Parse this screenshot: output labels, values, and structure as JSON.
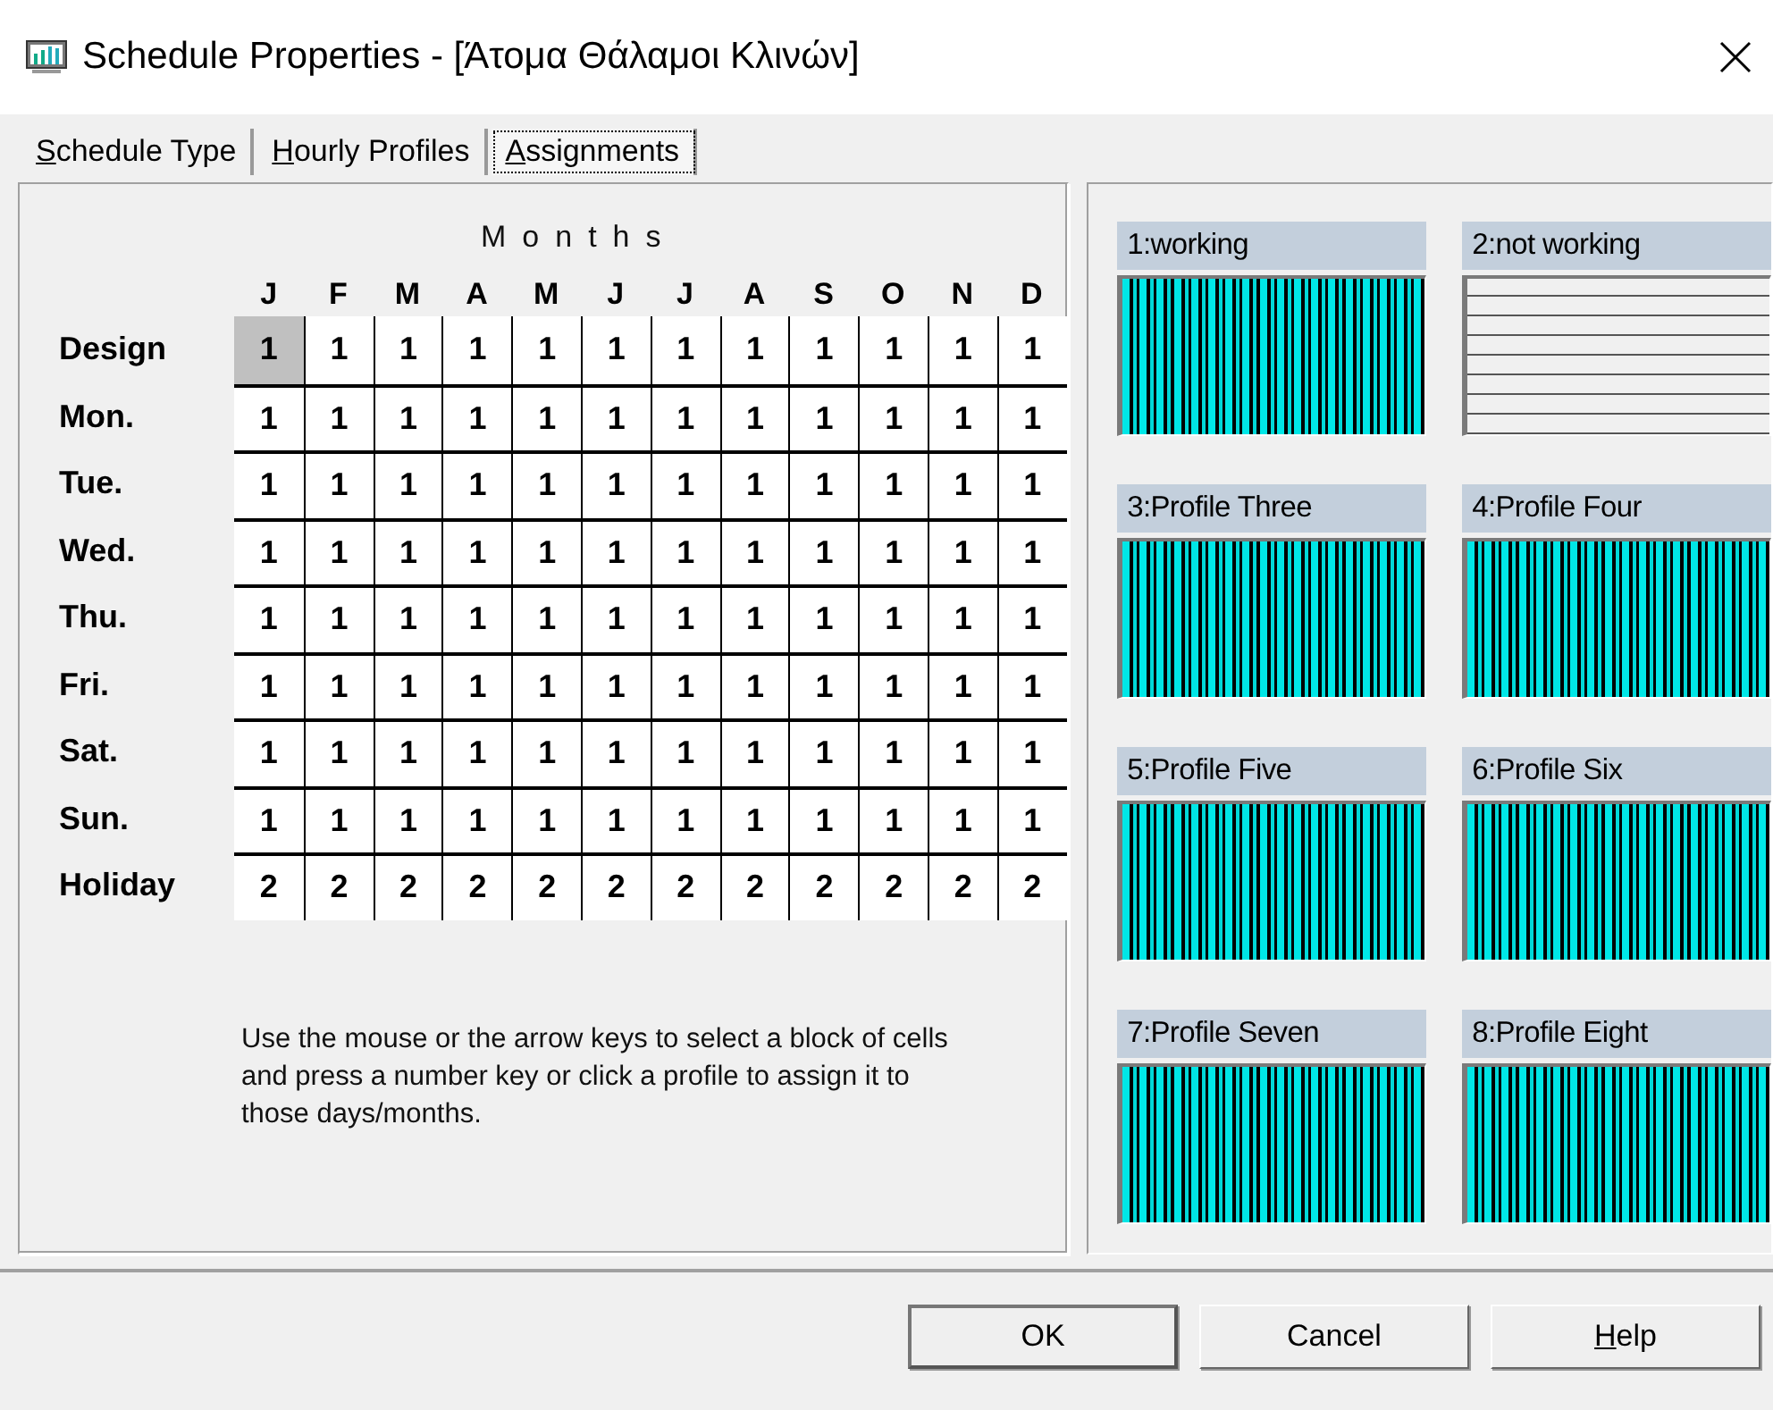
{
  "window": {
    "title": "Schedule Properties - [Άτομα Θάλαμοι Κλινών]"
  },
  "tabs": [
    {
      "label": "Schedule Type",
      "mnemonic": true,
      "selected": false
    },
    {
      "label": "Hourly Profiles",
      "mnemonic": true,
      "selected": false
    },
    {
      "label": "Assignments",
      "mnemonic": true,
      "selected": true
    }
  ],
  "grid": {
    "title": "Months",
    "columns": [
      "J",
      "F",
      "M",
      "A",
      "M",
      "J",
      "J",
      "A",
      "S",
      "O",
      "N",
      "D"
    ],
    "rows": [
      {
        "label": "Design",
        "cells": [
          {
            "value": "1",
            "selected": true
          },
          {
            "value": "1",
            "selected": false
          },
          {
            "value": "1",
            "selected": false
          },
          {
            "value": "1",
            "selected": false
          },
          {
            "value": "1",
            "selected": false
          },
          {
            "value": "1",
            "selected": false
          },
          {
            "value": "1",
            "selected": false
          },
          {
            "value": "1",
            "selected": false
          },
          {
            "value": "1",
            "selected": false
          },
          {
            "value": "1",
            "selected": false
          },
          {
            "value": "1",
            "selected": false
          },
          {
            "value": "1",
            "selected": false
          }
        ]
      },
      {
        "label": "Mon.",
        "cells": [
          {
            "value": "1",
            "selected": false
          },
          {
            "value": "1",
            "selected": false
          },
          {
            "value": "1",
            "selected": false
          },
          {
            "value": "1",
            "selected": false
          },
          {
            "value": "1",
            "selected": false
          },
          {
            "value": "1",
            "selected": false
          },
          {
            "value": "1",
            "selected": false
          },
          {
            "value": "1",
            "selected": false
          },
          {
            "value": "1",
            "selected": false
          },
          {
            "value": "1",
            "selected": false
          },
          {
            "value": "1",
            "selected": false
          },
          {
            "value": "1",
            "selected": false
          }
        ]
      },
      {
        "label": "Tue.",
        "cells": [
          {
            "value": "1",
            "selected": false
          },
          {
            "value": "1",
            "selected": false
          },
          {
            "value": "1",
            "selected": false
          },
          {
            "value": "1",
            "selected": false
          },
          {
            "value": "1",
            "selected": false
          },
          {
            "value": "1",
            "selected": false
          },
          {
            "value": "1",
            "selected": false
          },
          {
            "value": "1",
            "selected": false
          },
          {
            "value": "1",
            "selected": false
          },
          {
            "value": "1",
            "selected": false
          },
          {
            "value": "1",
            "selected": false
          },
          {
            "value": "1",
            "selected": false
          }
        ]
      },
      {
        "label": "Wed.",
        "cells": [
          {
            "value": "1",
            "selected": false
          },
          {
            "value": "1",
            "selected": false
          },
          {
            "value": "1",
            "selected": false
          },
          {
            "value": "1",
            "selected": false
          },
          {
            "value": "1",
            "selected": false
          },
          {
            "value": "1",
            "selected": false
          },
          {
            "value": "1",
            "selected": false
          },
          {
            "value": "1",
            "selected": false
          },
          {
            "value": "1",
            "selected": false
          },
          {
            "value": "1",
            "selected": false
          },
          {
            "value": "1",
            "selected": false
          },
          {
            "value": "1",
            "selected": false
          }
        ]
      },
      {
        "label": "Thu.",
        "cells": [
          {
            "value": "1",
            "selected": false
          },
          {
            "value": "1",
            "selected": false
          },
          {
            "value": "1",
            "selected": false
          },
          {
            "value": "1",
            "selected": false
          },
          {
            "value": "1",
            "selected": false
          },
          {
            "value": "1",
            "selected": false
          },
          {
            "value": "1",
            "selected": false
          },
          {
            "value": "1",
            "selected": false
          },
          {
            "value": "1",
            "selected": false
          },
          {
            "value": "1",
            "selected": false
          },
          {
            "value": "1",
            "selected": false
          },
          {
            "value": "1",
            "selected": false
          }
        ]
      },
      {
        "label": "Fri.",
        "cells": [
          {
            "value": "1",
            "selected": false
          },
          {
            "value": "1",
            "selected": false
          },
          {
            "value": "1",
            "selected": false
          },
          {
            "value": "1",
            "selected": false
          },
          {
            "value": "1",
            "selected": false
          },
          {
            "value": "1",
            "selected": false
          },
          {
            "value": "1",
            "selected": false
          },
          {
            "value": "1",
            "selected": false
          },
          {
            "value": "1",
            "selected": false
          },
          {
            "value": "1",
            "selected": false
          },
          {
            "value": "1",
            "selected": false
          },
          {
            "value": "1",
            "selected": false
          }
        ]
      },
      {
        "label": "Sat.",
        "cells": [
          {
            "value": "1",
            "selected": false
          },
          {
            "value": "1",
            "selected": false
          },
          {
            "value": "1",
            "selected": false
          },
          {
            "value": "1",
            "selected": false
          },
          {
            "value": "1",
            "selected": false
          },
          {
            "value": "1",
            "selected": false
          },
          {
            "value": "1",
            "selected": false
          },
          {
            "value": "1",
            "selected": false
          },
          {
            "value": "1",
            "selected": false
          },
          {
            "value": "1",
            "selected": false
          },
          {
            "value": "1",
            "selected": false
          },
          {
            "value": "1",
            "selected": false
          }
        ]
      },
      {
        "label": "Sun.",
        "cells": [
          {
            "value": "1",
            "selected": false
          },
          {
            "value": "1",
            "selected": false
          },
          {
            "value": "1",
            "selected": false
          },
          {
            "value": "1",
            "selected": false
          },
          {
            "value": "1",
            "selected": false
          },
          {
            "value": "1",
            "selected": false
          },
          {
            "value": "1",
            "selected": false
          },
          {
            "value": "1",
            "selected": false
          },
          {
            "value": "1",
            "selected": false
          },
          {
            "value": "1",
            "selected": false
          },
          {
            "value": "1",
            "selected": false
          },
          {
            "value": "1",
            "selected": false
          }
        ]
      },
      {
        "label": "Holiday",
        "cells": [
          {
            "value": "2",
            "selected": false
          },
          {
            "value": "2",
            "selected": false
          },
          {
            "value": "2",
            "selected": false
          },
          {
            "value": "2",
            "selected": false
          },
          {
            "value": "2",
            "selected": false
          },
          {
            "value": "2",
            "selected": false
          },
          {
            "value": "2",
            "selected": false
          },
          {
            "value": "2",
            "selected": false
          },
          {
            "value": "2",
            "selected": false
          },
          {
            "value": "2",
            "selected": false
          },
          {
            "value": "2",
            "selected": false
          },
          {
            "value": "2",
            "selected": false
          }
        ]
      }
    ],
    "instructions": "Use the mouse or the arrow keys to select a block of cells and press a number key or click a profile to assign it to those days/months."
  },
  "profiles": [
    {
      "name": "1:working",
      "kind": "bars"
    },
    {
      "name": "2:not working",
      "kind": "lines"
    },
    {
      "name": "3:Profile Three",
      "kind": "bars"
    },
    {
      "name": "4:Profile Four",
      "kind": "bars"
    },
    {
      "name": "5:Profile Five",
      "kind": "bars"
    },
    {
      "name": "6:Profile Six",
      "kind": "bars"
    },
    {
      "name": "7:Profile Seven",
      "kind": "bars"
    },
    {
      "name": "8:Profile Eight",
      "kind": "bars"
    }
  ],
  "buttons": [
    {
      "label": "OK",
      "mnemonic": false,
      "default": true
    },
    {
      "label": "Cancel",
      "mnemonic": false,
      "default": false
    },
    {
      "label": "Help",
      "mnemonic": true,
      "default": false
    }
  ]
}
